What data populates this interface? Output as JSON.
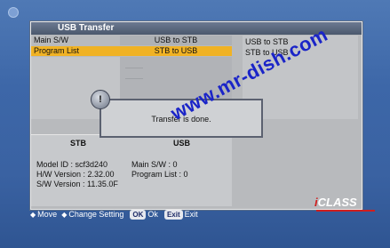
{
  "window": {
    "title": "USB Transfer"
  },
  "rows": [
    {
      "label": "Main S/W",
      "value": "USB to STB"
    },
    {
      "label": "Program List",
      "value": "STB to USB"
    }
  ],
  "right_list": [
    "USB to STB",
    "STB to USB"
  ],
  "info": {
    "stb_header": "STB",
    "usb_header": "USB",
    "model_id": "Model ID : scf3d240",
    "hw_version": "H/W Version : 2.32.00",
    "sw_version": "S/W Version : 11.35.0F",
    "usb_main_sw": "Main S/W : 0",
    "usb_program_list": "Program List : 0"
  },
  "dialog": {
    "message": "Transfer is done.",
    "icon_glyph": "!"
  },
  "watermark": "www.mr-dish.com",
  "help": {
    "move": "Move",
    "change_setting": "Change Setting",
    "ok_key": "OK",
    "ok": "Ok",
    "exit_key": "Exit",
    "exit": "Exit"
  },
  "brand": {
    "prefix": "i",
    "name": "CLASS"
  },
  "colors": {
    "highlight": "#f0b224",
    "watermark": "#1a24c8",
    "background": "#3d67a8",
    "brand": "#d01e1e"
  }
}
